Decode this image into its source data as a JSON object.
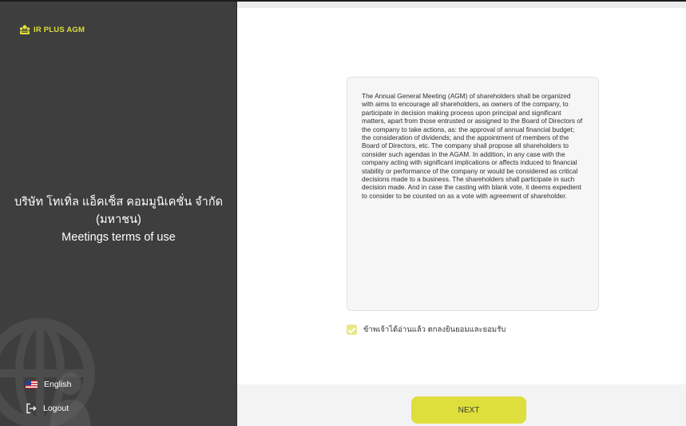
{
  "brand": {
    "name": "IR PLUS AGM",
    "accent": "#dede3c"
  },
  "sidebar": {
    "company_name": "บริษัท โทเทิ่ล แอ็คเซ็ส คอมมูนิเคชั่น จำกัด (มหาชน)",
    "subtitle": "Meetings terms of use",
    "language": "English",
    "language_icon": "us-flag-icon",
    "logout": "Logout",
    "logout_icon": "logout-icon"
  },
  "terms": {
    "text": "The Annual General Meeting (AGM) of shareholders shall be organized with aims to encourage all shareholders, as owners of the company, to participate in decision making process upon principal and significant matters, apart from those entrusted or assigned to the Board of Directors of the company to take actions, as: the approval of annual financial budget; the consideration of dividends; and the appointment of members of the Board of Directors, etc. The company shall propose all shareholders to consider such agendas in the AGAM. In addition, in any case with the company acting with significant implications or affects induced to financial stability or performance of the company or would be considered as critical decisions made to a business. The shareholders shall participate in such decision made. And in case the casting with blank vote, it deems expedient to consider to be counted on as a vote with agreement of shareholder."
  },
  "agreement": {
    "label": "ข้าพเจ้าได้อ่านแล้ว ตกลงยินยอมและยอมรับ",
    "checked": true
  },
  "actions": {
    "next": "NEXT"
  }
}
